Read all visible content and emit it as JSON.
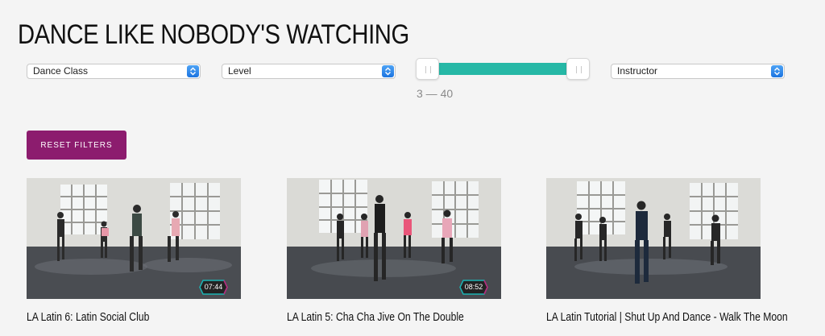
{
  "page": {
    "title": "DANCE LIKE NOBODY'S WATCHING"
  },
  "filters": {
    "dance_class": {
      "value": "Dance Class"
    },
    "level": {
      "value": "Level"
    },
    "instructor": {
      "value": "Instructor"
    },
    "duration_range": {
      "min": 3,
      "max": 40,
      "label": "3 — 40"
    },
    "reset_label": "RESET FILTERS"
  },
  "colors": {
    "accent": "#8c1c6e",
    "slider": "#26b8a6",
    "select_arrow": "#1c74e0"
  },
  "videos": [
    {
      "title": "LA Latin 6: Latin Social Club",
      "duration": "07:44"
    },
    {
      "title": "LA Latin 5: Cha Cha Jive On The Double",
      "duration": "08:52"
    },
    {
      "title": "LA Latin Tutorial | Shut Up And Dance - Walk The Moon",
      "duration": ""
    }
  ]
}
